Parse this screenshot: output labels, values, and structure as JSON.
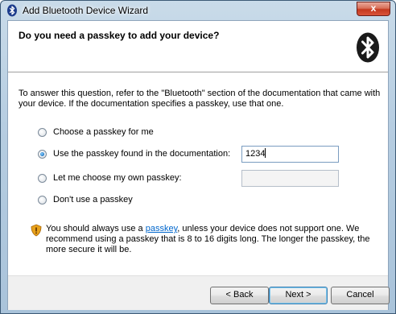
{
  "window": {
    "title": "Add Bluetooth Device Wizard",
    "close_label": "x"
  },
  "header": {
    "title": "Do you need a passkey to add your device?"
  },
  "description": "To answer this question, refer to the \"Bluetooth\" section of the documentation that came with your device. If the documentation specifies a passkey, use that one.",
  "options": [
    {
      "label": "Choose a passkey for me",
      "checked": false
    },
    {
      "label": "Use the passkey found in the documentation:",
      "checked": true
    },
    {
      "label": "Let me choose my own passkey:",
      "checked": false
    },
    {
      "label": "Don't use a passkey",
      "checked": false
    }
  ],
  "passkey_doc_value": "1234",
  "passkey_own_value": "",
  "note": {
    "before_link": "You should always use a ",
    "link": "passkey",
    "after_link": ", unless your device does not support one. We recommend using a passkey that is 8 to 16 digits long. The longer the passkey, the more secure it will be."
  },
  "buttons": {
    "back": "< Back",
    "next": "Next >",
    "cancel": "Cancel"
  },
  "colors": {
    "bluetooth": "#1a1a1a",
    "link": "#0066cc",
    "warning_shield": "#e8a21b"
  }
}
